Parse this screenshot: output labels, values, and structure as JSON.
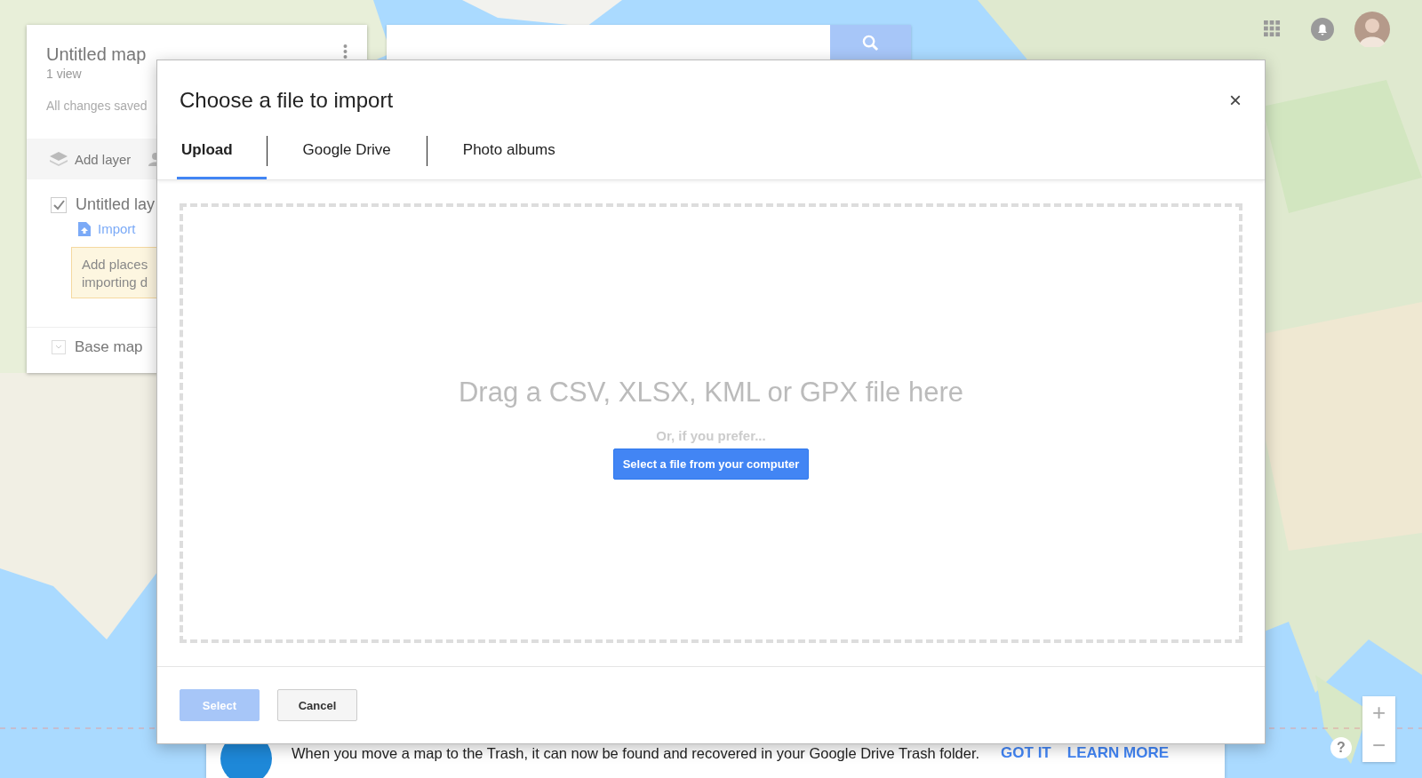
{
  "side_panel": {
    "title": "Untitled map",
    "views": "1 view",
    "save_status": "All changes saved",
    "add_layer": "Add layer",
    "layer": {
      "name": "Untitled lay",
      "checked": true,
      "import_link": "Import"
    },
    "tooltip_lines": [
      "Add places",
      "importing d"
    ],
    "base_map": "Base map"
  },
  "dialog": {
    "title": "Choose a file to import",
    "close": "×",
    "tabs": [
      {
        "label": "Upload",
        "selected": true
      },
      {
        "label": "Google Drive",
        "selected": false
      },
      {
        "label": "Photo albums",
        "selected": false
      }
    ],
    "drop_text": "Drag a CSV, XLSX, KML or GPX file here",
    "or_text": "Or, if you prefer...",
    "file_button": "Select a file from your computer",
    "buttons": [
      {
        "label": "Select",
        "kind": "primary",
        "disabled": true
      },
      {
        "label": "Cancel",
        "kind": "secondary",
        "disabled": false
      }
    ]
  },
  "banner": {
    "message": "When you move a map to the Trash, it can now be found and recovered in your Google Drive Trash folder.",
    "actions": [
      "GOT IT",
      "LEARN MORE"
    ]
  },
  "zoom_controls": [
    "+",
    "−"
  ],
  "help": "?"
}
